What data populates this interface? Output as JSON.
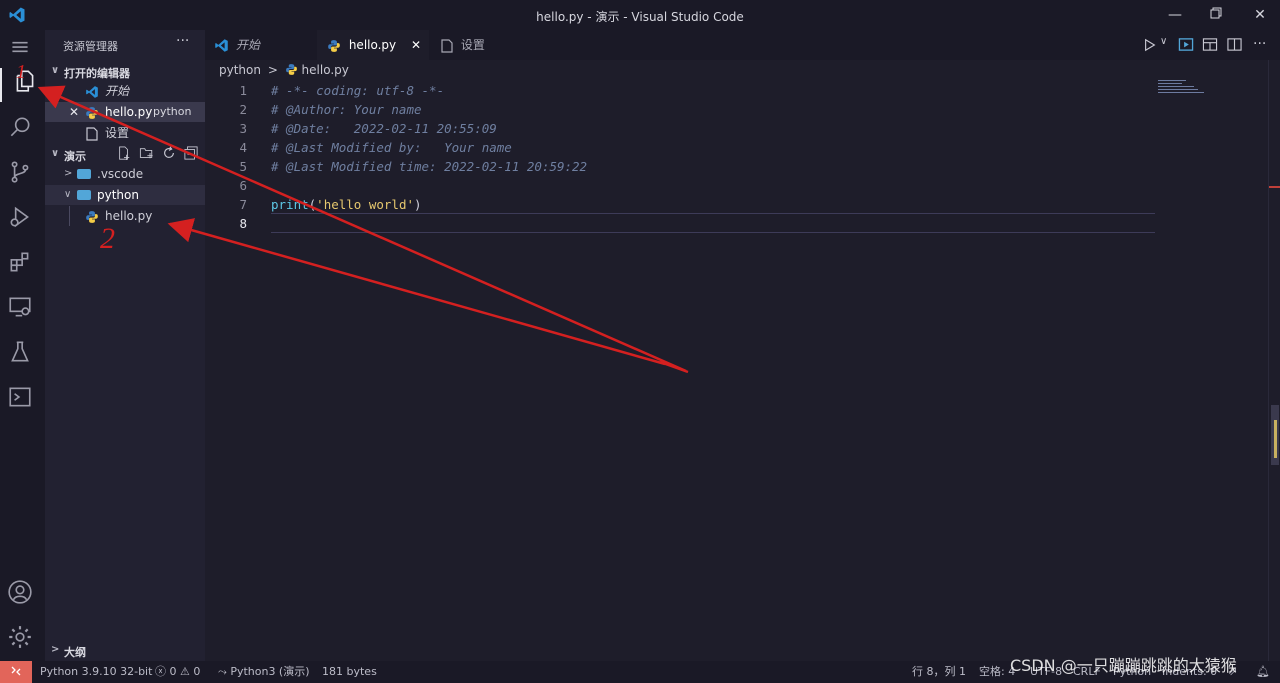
{
  "window": {
    "title": "hello.py - 演示 - Visual Studio Code"
  },
  "sidebar": {
    "title": "资源管理器",
    "more": "···",
    "open_editors": {
      "header": "打开的编辑器",
      "items": [
        {
          "label": "开始"
        },
        {
          "label": "hello.py",
          "hint": "python"
        },
        {
          "label": "设置"
        }
      ]
    },
    "workspace": {
      "header": "演示",
      "tree": [
        {
          "label": ".vscode"
        },
        {
          "label": "python"
        },
        {
          "label": "hello.py"
        }
      ]
    },
    "outline": {
      "header": "大纲"
    }
  },
  "tabs": [
    {
      "label": "开始"
    },
    {
      "label": "hello.py"
    },
    {
      "label": "设置"
    }
  ],
  "breadcrumb": {
    "folder": "python",
    "sep": ">",
    "file": "hello.py"
  },
  "editor": {
    "line_numbers": [
      "1",
      "2",
      "3",
      "4",
      "5",
      "6",
      "7",
      "8"
    ],
    "lines": [
      "# -*- coding: utf-8 -*-",
      "# @Author: Your name",
      "# @Date:   2022-02-11 20:55:09",
      "# @Last Modified by:   Your name",
      "# @Last Modified time: 2022-02-11 20:59:22",
      "",
      {
        "fn": "print",
        "open": "(",
        "str": "'hello world'",
        "close": ")"
      },
      ""
    ]
  },
  "statusbar": {
    "interpreter": "Python 3.9.10 32-bit",
    "errors": "0",
    "warnings": "0",
    "kernel": "Python3 (演示)",
    "size": "181 bytes",
    "position": "行 8，列 1",
    "spaces": "空格: 4",
    "encoding": "UTF-8",
    "eol": "CRLF",
    "language": "Python",
    "indents": "Indents: 0"
  },
  "annotations": {
    "mark1": "1",
    "mark2": "2"
  },
  "watermark": "CSDN @一只蹦蹦跳跳的大猿猴",
  "colors": {
    "accent": "#52a6d8",
    "annotation": "#d42020",
    "remote": "#e2655a"
  }
}
